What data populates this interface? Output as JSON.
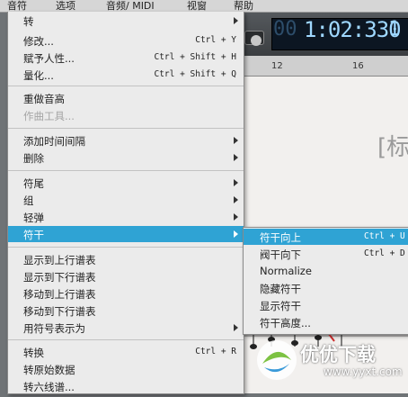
{
  "menubar": [
    "音符",
    "选项",
    "音频/ MIDI",
    "视窗",
    "帮助"
  ],
  "transport": {
    "time": "1:02:330",
    "prefix": "00",
    "right": "1"
  },
  "ruler": [
    "12",
    "16"
  ],
  "score": {
    "title": "[标"
  },
  "watermark": {
    "brand": "优优下载",
    "url": "www.yyxt.com"
  },
  "menu": {
    "items": [
      {
        "label": "转",
        "shortcut": "",
        "submenu": true,
        "disabled": false,
        "selected": false
      },
      {
        "label": "修改...",
        "shortcut": "Ctrl + Y",
        "submenu": false,
        "disabled": false,
        "selected": false
      },
      {
        "label": "赋予人性...",
        "shortcut": "Ctrl + Shift + H",
        "submenu": false,
        "disabled": false,
        "selected": false
      },
      {
        "label": "量化...",
        "shortcut": "Ctrl + Shift + Q",
        "submenu": false,
        "disabled": false,
        "selected": false
      },
      {
        "label": "重做音高",
        "shortcut": "",
        "submenu": false,
        "disabled": false,
        "selected": false
      },
      {
        "label": "作曲工具...",
        "shortcut": "",
        "submenu": false,
        "disabled": true,
        "selected": false
      },
      {
        "label": "添加时间间隔",
        "shortcut": "",
        "submenu": true,
        "disabled": false,
        "selected": false
      },
      {
        "label": "删除",
        "shortcut": "",
        "submenu": true,
        "disabled": false,
        "selected": false
      },
      {
        "label": "符尾",
        "shortcut": "",
        "submenu": true,
        "disabled": false,
        "selected": false
      },
      {
        "label": "组",
        "shortcut": "",
        "submenu": true,
        "disabled": false,
        "selected": false
      },
      {
        "label": "轻弹",
        "shortcut": "",
        "submenu": true,
        "disabled": false,
        "selected": false
      },
      {
        "label": "符干",
        "shortcut": "",
        "submenu": true,
        "disabled": false,
        "selected": true
      },
      {
        "label": "显示到上行谱表",
        "shortcut": "",
        "submenu": false,
        "disabled": false,
        "selected": false
      },
      {
        "label": "显示到下行谱表",
        "shortcut": "",
        "submenu": false,
        "disabled": false,
        "selected": false
      },
      {
        "label": "移动到上行谱表",
        "shortcut": "",
        "submenu": false,
        "disabled": false,
        "selected": false
      },
      {
        "label": "移动到下行谱表",
        "shortcut": "",
        "submenu": false,
        "disabled": false,
        "selected": false
      },
      {
        "label": "用符号表示为",
        "shortcut": "",
        "submenu": true,
        "disabled": false,
        "selected": false
      },
      {
        "label": "转换",
        "shortcut": "Ctrl + R",
        "submenu": false,
        "disabled": false,
        "selected": false
      },
      {
        "label": "转原始数据",
        "shortcut": "",
        "submenu": false,
        "disabled": false,
        "selected": false
      },
      {
        "label": "转六线谱...",
        "shortcut": "",
        "submenu": false,
        "disabled": false,
        "selected": false
      }
    ]
  },
  "submenu": {
    "items": [
      {
        "label": "符干向上",
        "shortcut": "Ctrl + U",
        "selected": true
      },
      {
        "label": "阀干向下",
        "shortcut": "Ctrl + D",
        "selected": false
      },
      {
        "label": "Normalize",
        "shortcut": "",
        "selected": false
      },
      {
        "label": "隐藏符干",
        "shortcut": "",
        "selected": false
      },
      {
        "label": "显示符干",
        "shortcut": "",
        "selected": false
      },
      {
        "label": "符干高度...",
        "shortcut": "",
        "selected": false
      }
    ]
  },
  "colors": {
    "highlight": "#2fa3d4",
    "menu_bg": "#ebebeb",
    "lcd": "#9fd8ff"
  }
}
